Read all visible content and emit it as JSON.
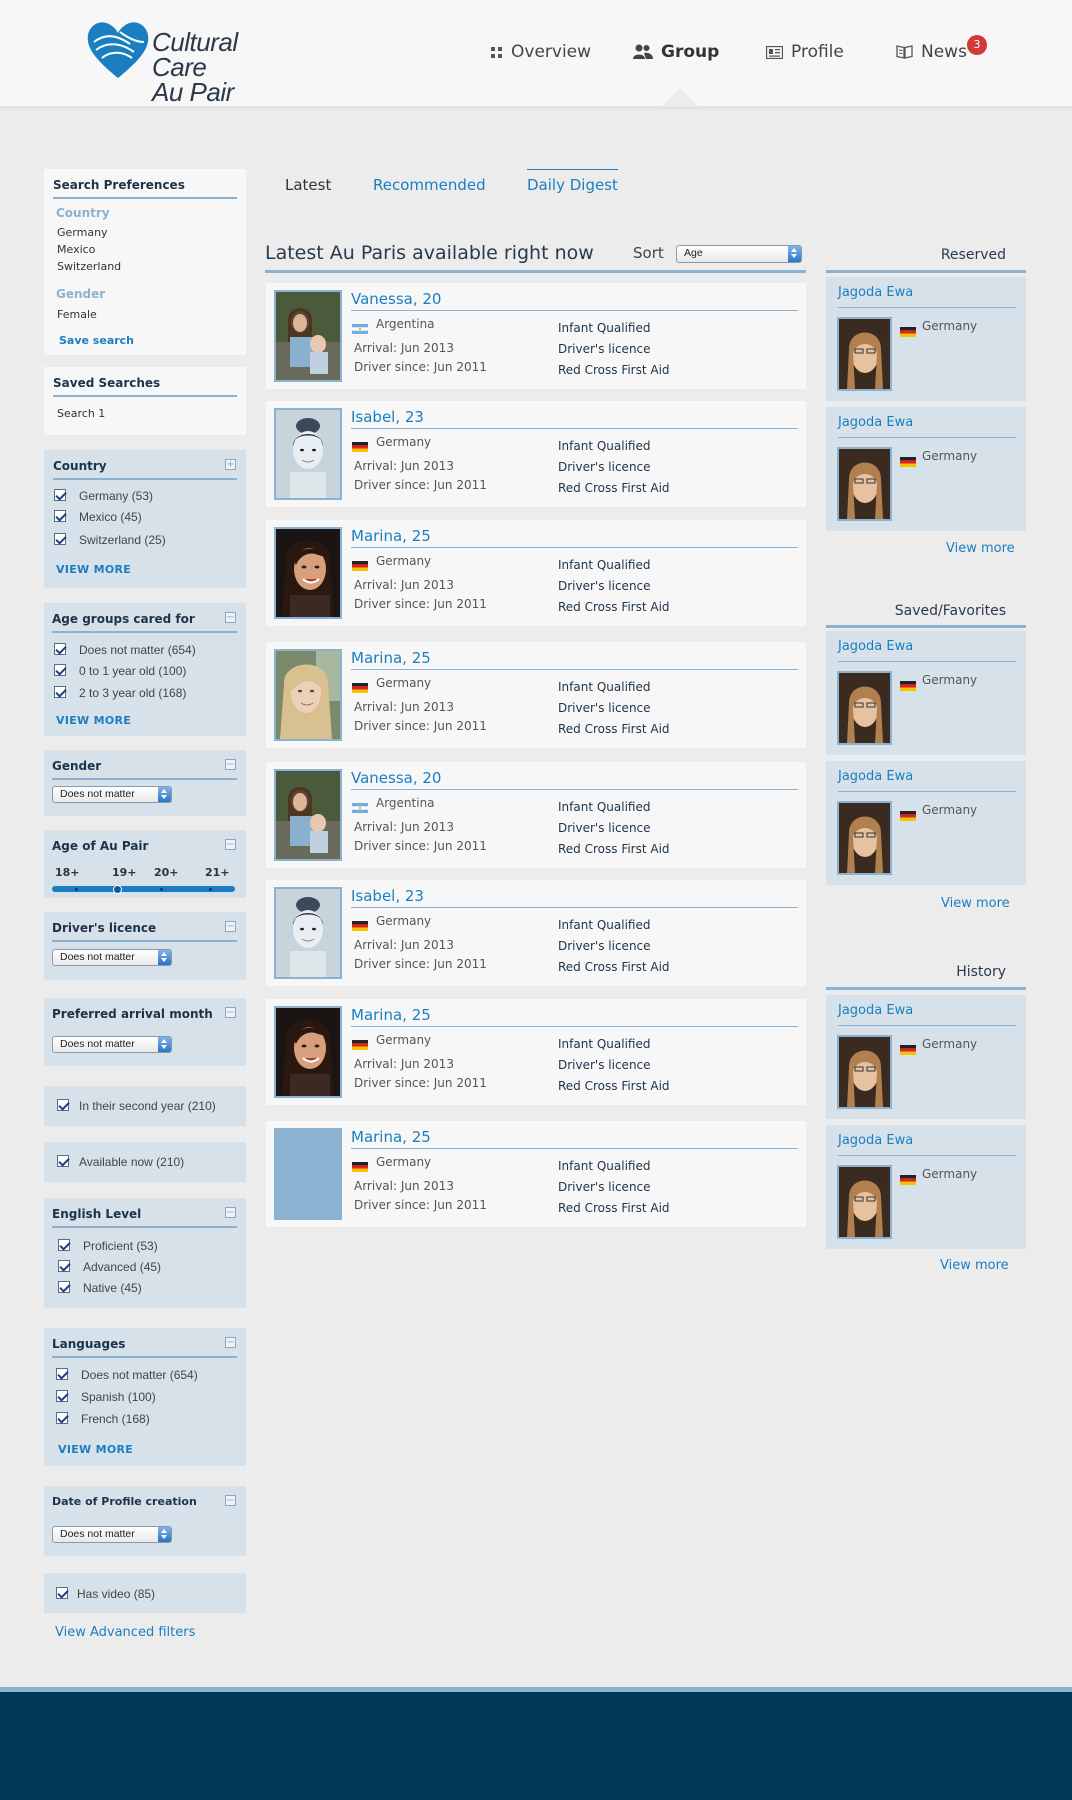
{
  "brand": {
    "line1": "Cultural Care",
    "line2": "Au Pair",
    "color": "#1a7ec1"
  },
  "nav": [
    {
      "label": "Overview",
      "icon": "grid-icon"
    },
    {
      "label": "Group",
      "icon": "group-icon"
    },
    {
      "label": "Profile",
      "icon": "id-card-icon"
    },
    {
      "label": "News",
      "icon": "book-icon"
    }
  ],
  "news_badge": "3",
  "search_prefs": {
    "title": "Search Preferences",
    "country_label": "Country",
    "countries": [
      "Germany",
      "Mexico",
      "Switzerland"
    ],
    "gender_label": "Gender",
    "gender": "Female",
    "save": "Save search"
  },
  "saved_searches": {
    "title": "Saved Searches",
    "items": [
      "Search 1"
    ]
  },
  "filters": {
    "country": {
      "title": "Country",
      "items": [
        "Germany (53)",
        "Mexico (45)",
        "Switzerland (25)"
      ],
      "more": "VIEW MORE"
    },
    "age_groups": {
      "title": "Age groups cared for",
      "items": [
        "Does not matter (654)",
        "0 to 1 year old (100)",
        "2 to 3 year old (168)"
      ],
      "more": "VIEW MORE"
    },
    "gender": {
      "title": "Gender",
      "value": "Does not matter"
    },
    "age_au_pair": {
      "title": "Age of Au Pair",
      "ticks": [
        "18+",
        "19+",
        "20+",
        "21+"
      ]
    },
    "drivers": {
      "title": "Driver's licence",
      "value": "Does not matter"
    },
    "arrival": {
      "title": "Preferred arrival month",
      "value": "Does not matter"
    },
    "second_year": "In their second year (210)",
    "available_now": "Available now (210)",
    "english": {
      "title": "English Level",
      "items": [
        "Proficient (53)",
        "Advanced (45)",
        "Native (45)"
      ]
    },
    "languages": {
      "title": "Languages",
      "items": [
        "Does not matter (654)",
        "Spanish (100)",
        "French (168)"
      ],
      "more": "VIEW MORE"
    },
    "profile_date": {
      "title": "Date of Profile creation",
      "value": "Does not matter"
    },
    "has_video": "Has video (85)",
    "advanced": "View Advanced filters"
  },
  "tabs": [
    "Latest",
    "Recommended",
    "Daily Digest"
  ],
  "main": {
    "title": "Latest Au Paris available right now",
    "sort_label": "Sort",
    "sort_value": "Age"
  },
  "cards": [
    {
      "name": "Vanessa, 20",
      "country": "Argentina",
      "arrival": "Arrival: Jun 2013",
      "driver": "Driver since: Jun 2011",
      "q": [
        "Infant Qualified",
        "Driver's licence",
        "Red Cross First Aid"
      ]
    },
    {
      "name": "Isabel, 23",
      "country": "Germany",
      "arrival": "Arrival: Jun 2013",
      "driver": "Driver since: Jun 2011",
      "q": [
        "Infant Qualified",
        "Driver's licence",
        "Red Cross First Aid"
      ]
    },
    {
      "name": "Marina, 25",
      "country": "Germany",
      "arrival": "Arrival: Jun 2013",
      "driver": "Driver since: Jun 2011",
      "q": [
        "Infant Qualified",
        "Driver's licence",
        "Red Cross First Aid"
      ]
    },
    {
      "name": "Marina, 25",
      "country": "Germany",
      "arrival": "Arrival: Jun 2013",
      "driver": "Driver since: Jun 2011",
      "q": [
        "Infant Qualified",
        "Driver's licence",
        "Red Cross First Aid"
      ]
    },
    {
      "name": "Vanessa, 20",
      "country": "Argentina",
      "arrival": "Arrival: Jun 2013",
      "driver": "Driver since: Jun 2011",
      "q": [
        "Infant Qualified",
        "Driver's licence",
        "Red Cross First Aid"
      ]
    },
    {
      "name": "Isabel, 23",
      "country": "Germany",
      "arrival": "Arrival: Jun 2013",
      "driver": "Driver since: Jun 2011",
      "q": [
        "Infant Qualified",
        "Driver's licence",
        "Red Cross First Aid"
      ]
    },
    {
      "name": "Marina, 25",
      "country": "Germany",
      "arrival": "Arrival: Jun 2013",
      "driver": "Driver since: Jun 2011",
      "q": [
        "Infant Qualified",
        "Driver's licence",
        "Red Cross First Aid"
      ]
    },
    {
      "name": "Marina, 25",
      "country": "Germany",
      "arrival": "Arrival: Jun 2013",
      "driver": "Driver since: Jun 2011",
      "q": [
        "Infant Qualified",
        "Driver's licence",
        "Red Cross First Aid"
      ]
    }
  ],
  "right": {
    "reserved": {
      "title": "Reserved",
      "items": [
        {
          "name": "Jagoda Ewa",
          "country": "Germany"
        },
        {
          "name": "Jagoda Ewa",
          "country": "Germany"
        }
      ],
      "more": "View more"
    },
    "saved": {
      "title": "Saved/Favorites",
      "items": [
        {
          "name": "Jagoda Ewa",
          "country": "Germany"
        },
        {
          "name": "Jagoda Ewa",
          "country": "Germany"
        }
      ],
      "more": "View more"
    },
    "history": {
      "title": "History",
      "items": [
        {
          "name": "Jagoda Ewa",
          "country": "Germany"
        },
        {
          "name": "Jagoda Ewa",
          "country": "Germany"
        }
      ],
      "more": "View more"
    }
  }
}
